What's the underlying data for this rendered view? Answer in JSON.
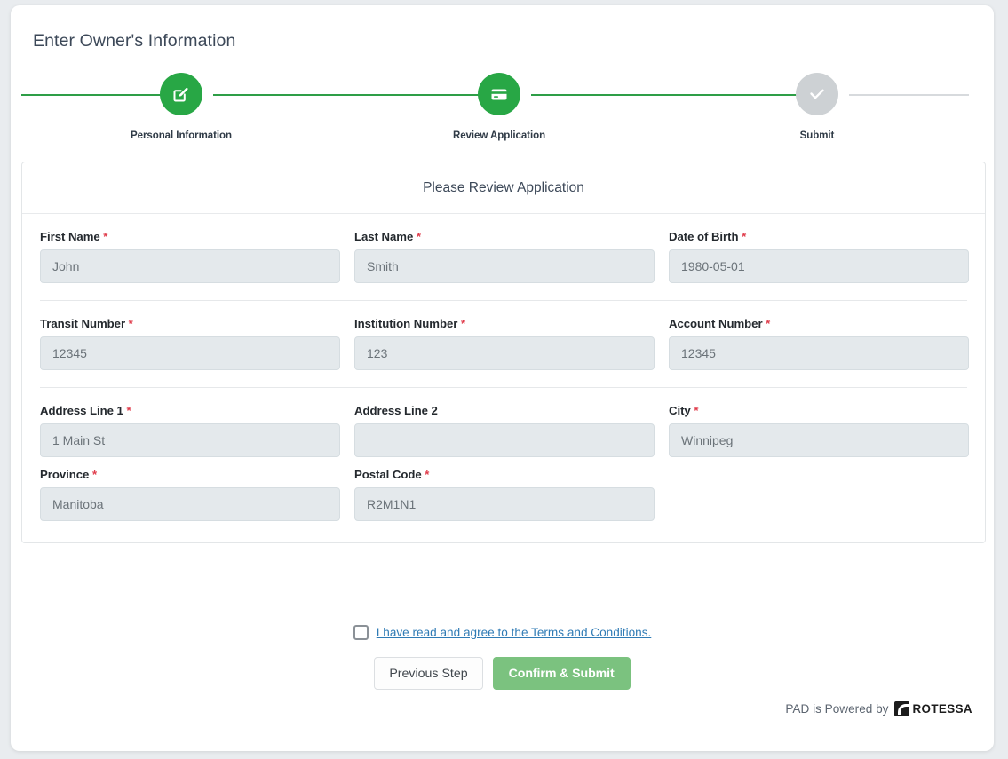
{
  "page": {
    "title": "Enter Owner's Information"
  },
  "stepper": {
    "steps": [
      {
        "label": "Personal Information",
        "icon": "edit-square-icon",
        "state": "active"
      },
      {
        "label": "Review Application",
        "icon": "credit-card-icon",
        "state": "active"
      },
      {
        "label": "Submit",
        "icon": "check-icon",
        "state": "inactive"
      }
    ],
    "colors": {
      "active": "#28a745",
      "inactive": "#cdd1d4",
      "line_done": "#2e9e47",
      "line_todo": "#d7dadd"
    }
  },
  "panel": {
    "heading": "Please Review Application",
    "required_marker": "*",
    "fields": {
      "first_name": {
        "label": "First Name",
        "required": true,
        "value": "John"
      },
      "last_name": {
        "label": "Last Name",
        "required": true,
        "value": "Smith"
      },
      "date_of_birth": {
        "label": "Date of Birth",
        "required": true,
        "value": "1980-05-01"
      },
      "transit_number": {
        "label": "Transit Number",
        "required": true,
        "value": "12345"
      },
      "institution_number": {
        "label": "Institution Number",
        "required": true,
        "value": "123"
      },
      "account_number": {
        "label": "Account Number",
        "required": true,
        "value": "12345"
      },
      "address_line_1": {
        "label": "Address Line 1",
        "required": true,
        "value": "1 Main St"
      },
      "address_line_2": {
        "label": "Address Line 2",
        "required": false,
        "value": ""
      },
      "city": {
        "label": "City",
        "required": true,
        "value": "Winnipeg"
      },
      "province": {
        "label": "Province",
        "required": true,
        "value": "Manitoba"
      },
      "postal_code": {
        "label": "Postal Code",
        "required": true,
        "value": "R2M1N1"
      }
    }
  },
  "terms": {
    "link_text": "I have read and agree to the Terms and Conditions.",
    "checked": false
  },
  "actions": {
    "previous_label": "Previous Step",
    "submit_label": "Confirm & Submit",
    "submit_color": "#7bc27f"
  },
  "footer": {
    "text": "PAD is Powered by",
    "brand": "ROTESSA"
  }
}
